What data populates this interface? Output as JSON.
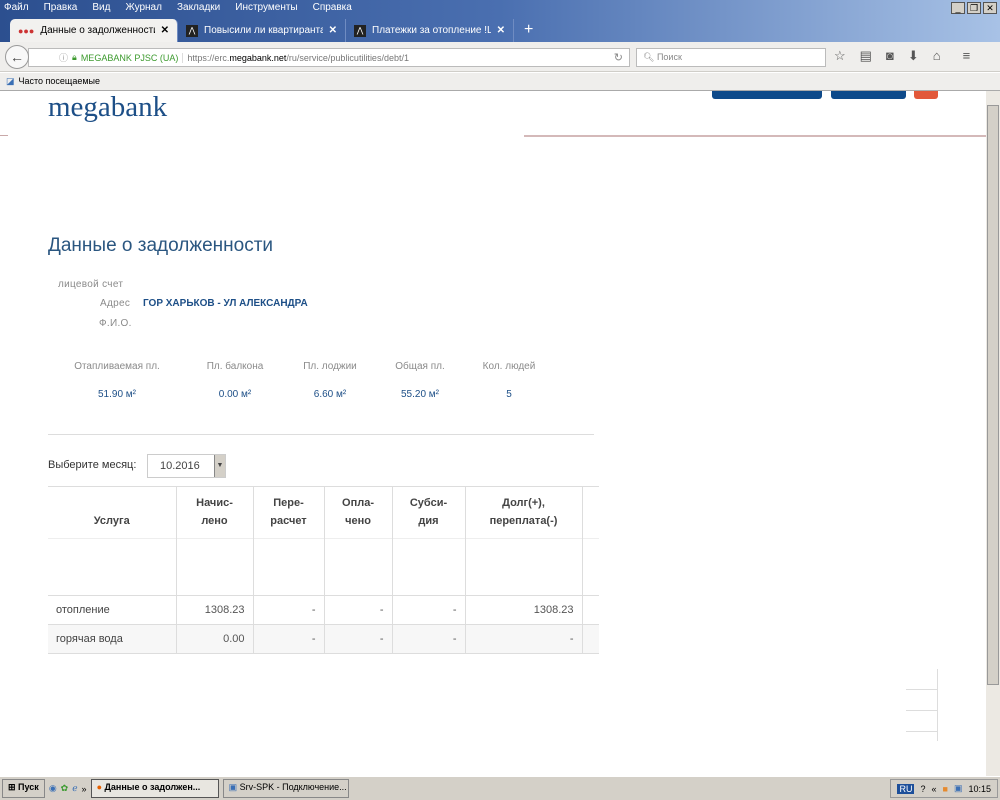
{
  "menu": [
    "Файл",
    "Правка",
    "Вид",
    "Журнал",
    "Закладки",
    "Инструменты",
    "Справка"
  ],
  "tabs": [
    {
      "label": "Данные о задолженности | ..."
    },
    {
      "label": "Повысили ли квартирантам ..."
    },
    {
      "label": "Платежки за отопление !Ш..."
    }
  ],
  "new_tab": "+",
  "nav": {
    "org": "MEGABANK PJSC (UA)",
    "url_prefix": "https://erc.",
    "url_domain": "megabank.net",
    "url_path": "/ru/service/publicutilities/debt/1",
    "search_placeholder": "Поиск"
  },
  "bookmarks": {
    "label": "Часто посещаемые"
  },
  "page": {
    "logo": "megabank",
    "title": "Данные о задолженности",
    "account_label": "лицевой счет",
    "address_label": "Адрес",
    "address_value": "ГОР ХАРЬКОВ - УЛ АЛЕКСАНДРА",
    "name_label": "Ф.И.О.",
    "stats": [
      {
        "label": "Отапливаемая пл.",
        "value": "51.90 м²"
      },
      {
        "label": "Пл. балкона",
        "value": "0.00 м²"
      },
      {
        "label": "Пл. лоджии",
        "value": "6.60 м²"
      },
      {
        "label": "Общая пл.",
        "value": "55.20 м²"
      },
      {
        "label": "Кол. людей",
        "value": "5"
      }
    ],
    "month_label": "Выберите месяц:",
    "month_value": "10.2016",
    "table": {
      "headers": [
        [
          "Услуга",
          ""
        ],
        [
          "Начис-",
          "лено"
        ],
        [
          "Пере-",
          "расчет"
        ],
        [
          "Опла-",
          "чено"
        ],
        [
          "Субси-",
          "дия"
        ],
        [
          "Долг(+),",
          "переплата(-)"
        ]
      ],
      "rows": [
        [
          "отопление",
          "1308.23",
          "-",
          "-",
          "-",
          "1308.23"
        ],
        [
          "горячая вода",
          "0.00",
          "-",
          "-",
          "-",
          "-"
        ]
      ]
    }
  },
  "taskbar": {
    "start": "Пуск",
    "items": [
      "Данные о задолжен...",
      "Srv-SPK - Подключение..."
    ],
    "lang": "RU",
    "clock": "10:15"
  }
}
